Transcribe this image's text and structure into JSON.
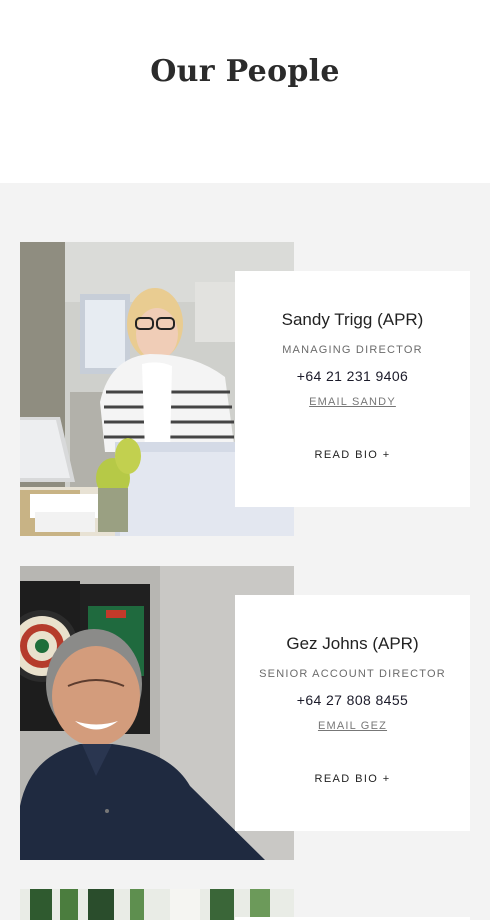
{
  "page": {
    "title": "Our People"
  },
  "people": [
    {
      "name": "Sandy Trigg (APR)",
      "role": "MANAGING DIRECTOR",
      "phone": "+64 21 231 9406",
      "email_label": "EMAIL SANDY",
      "bio_label": "READ BIO +"
    },
    {
      "name": "Gez Johns (APR)",
      "role": "SENIOR ACCOUNT DIRECTOR",
      "phone": "+64 27 808 8455",
      "email_label": "EMAIL GEZ",
      "bio_label": "READ BIO +"
    }
  ]
}
